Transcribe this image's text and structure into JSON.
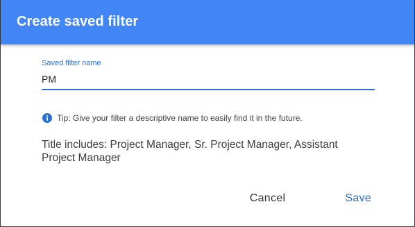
{
  "dialog": {
    "title": "Create saved filter"
  },
  "name_field": {
    "label": "Saved filter name",
    "value": "PM"
  },
  "tip": {
    "icon": "info-icon",
    "text": "Tip: Give your filter a descriptive name to easily find it in the future."
  },
  "summary": {
    "text": "Title includes: Project Manager, Sr. Project Manager, Assistant Project Manager"
  },
  "actions": {
    "cancel_label": "Cancel",
    "save_label": "Save"
  },
  "colors": {
    "header_bg": "#4285f4",
    "accent": "#2a6fd6"
  }
}
